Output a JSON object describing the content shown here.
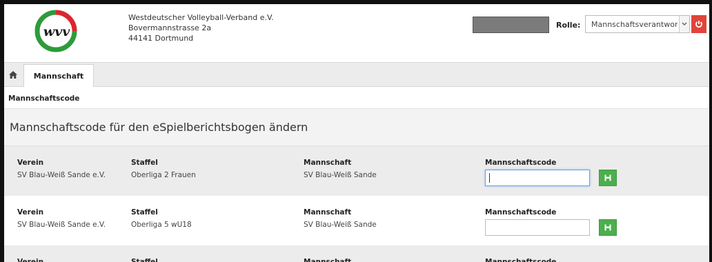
{
  "header": {
    "org_lines": [
      "Westdeutscher Volleyball-Verband e.V.",
      "Bovermannstrasse 2a",
      "44141 Dortmund"
    ],
    "logo_text": "wvv",
    "role_label": "Rolle:",
    "role_value": "Mannschaftsverantwortlicher"
  },
  "nav": {
    "home_icon": "home-icon",
    "tab_label": "Mannschaft"
  },
  "breadcrumb": "Mannschaftscode",
  "page_title": "Mannschaftscode für den eSpielberichtsbogen ändern",
  "columns": {
    "verein": "Verein",
    "staffel": "Staffel",
    "mannschaft": "Mannschaft",
    "code": "Mannschaftscode"
  },
  "rows": [
    {
      "verein": "SV Blau-Weiß Sande e.V.",
      "staffel": "Oberliga 2 Frauen",
      "mannschaft": "SV Blau-Weiß Sande",
      "code_value": ""
    },
    {
      "verein": "SV Blau-Weiß Sande e.V.",
      "staffel": "Oberliga 5 wU18",
      "mannschaft": "SV Blau-Weiß Sande",
      "code_value": ""
    },
    {
      "verein": "",
      "staffel": "",
      "mannschaft": "",
      "code_value": ""
    }
  ],
  "colors": {
    "save_green": "#4cae4c",
    "power_red": "#e0443a",
    "logo_green": "#2e9b3a",
    "logo_red": "#d9272e"
  }
}
